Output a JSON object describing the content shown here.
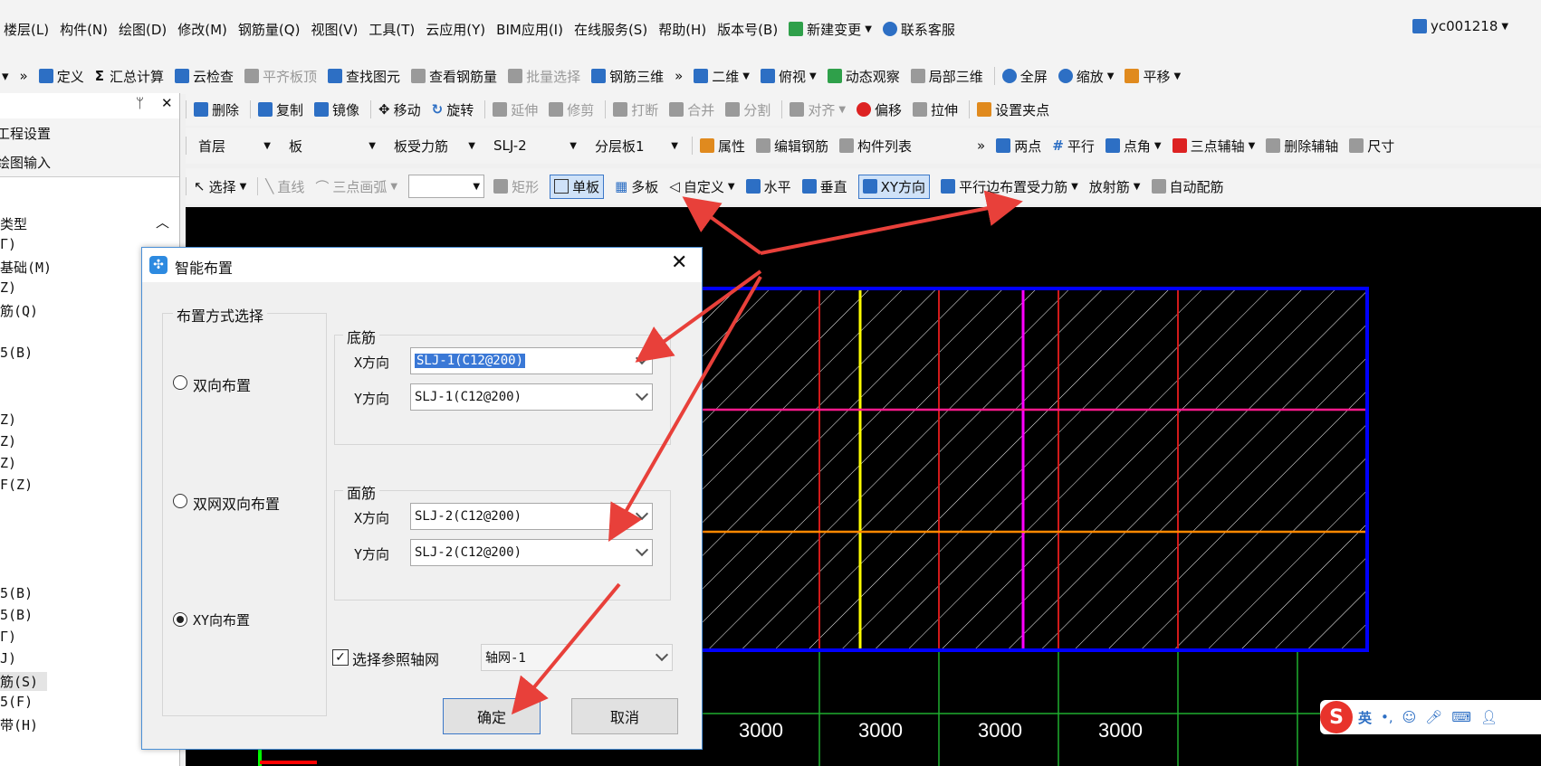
{
  "menu": {
    "items": [
      "楼层(L)",
      "构件(N)",
      "绘图(D)",
      "修改(M)",
      "钢筋量(Q)",
      "视图(V)",
      "工具(T)",
      "云应用(Y)",
      "BIM应用(I)",
      "在线服务(S)",
      "帮助(H)",
      "版本号(B)"
    ],
    "new_change": "新建变更",
    "support": "联系客服",
    "user": "yc001218"
  },
  "toolbar1": {
    "define": "定义",
    "sum": "汇总计算",
    "cloud_check": "云检查",
    "flush_slab": "平齐板顶",
    "find": "查找图元",
    "view_rebar": "查看钢筋量",
    "batch_select": "批量选择",
    "rebar_3d": "钢筋三维",
    "view_2d": "二维",
    "top_view": "俯视",
    "dynamic": "动态观察",
    "local_3d": "局部三维",
    "fullscreen": "全屏",
    "zoom": "缩放",
    "pan": "平移"
  },
  "toolbar2": {
    "delete": "删除",
    "copy": "复制",
    "mirror": "镜像",
    "move": "移动",
    "rotate": "旋转",
    "extend": "延伸",
    "trim": "修剪",
    "break": "打断",
    "merge": "合并",
    "split": "分割",
    "align": "对齐",
    "offset": "偏移",
    "stretch": "拉伸",
    "grip": "设置夹点"
  },
  "toolbar3": {
    "floor": "首层",
    "type": "板",
    "category": "板受力筋",
    "name": "SLJ-2",
    "layer": "分层板1",
    "props": "属性",
    "edit_rebar": "编辑钢筋",
    "comp_list": "构件列表",
    "two_point": "两点",
    "parallel": "平行",
    "point_angle": "点角",
    "three_point_axis": "三点辅轴",
    "del_axis": "删除辅轴",
    "dim": "尺寸"
  },
  "toolbar4": {
    "select": "选择",
    "line": "直线",
    "arc": "三点画弧",
    "rect": "矩形",
    "single": "单板",
    "multi": "多板",
    "custom": "自定义",
    "horizontal": "水平",
    "vertical": "垂直",
    "xy": "XY方向",
    "parallel_edge": "平行边布置受力筋",
    "radial": "放射筋",
    "auto": "自动配筋"
  },
  "leftpanel": {
    "pin": "ᛘ",
    "close": "✕",
    "project_settings": "工程设置",
    "drawing_input": "绘图输入",
    "items": [
      "类型",
      "Γ)",
      "基础(M)",
      "Z)",
      "筋(Q)",
      "5(B)",
      "Z)",
      "Z)",
      "Z)",
      "F(Z)",
      "5(B)",
      "5(B)",
      "Γ)",
      "J)",
      "筋(S)",
      "5(F)",
      "带(H)"
    ]
  },
  "dialog": {
    "title": "智能布置",
    "group_title": "布置方式选择",
    "radio_two_way": "双向布置",
    "radio_double_net": "双网双向布置",
    "radio_xy": "XY向布置",
    "bottom": "底筋",
    "top": "面筋",
    "x_label": "X方向",
    "y_label": "Y方向",
    "bottom_x": "SLJ-1(C12@200)",
    "bottom_y": "SLJ-1(C12@200)",
    "top_x": "SLJ-2(C12@200)",
    "top_y": "SLJ-2(C12@200)",
    "ref_grid": "选择参照轴网",
    "grid_value": "轴网-1",
    "ok": "确定",
    "cancel": "取消"
  },
  "canvas": {
    "dims": [
      "3000",
      "3000",
      "3000",
      "3000"
    ]
  },
  "ime": {
    "lang": "英",
    "punct": "•,"
  },
  "colors": {
    "slab_border": "#0000ff",
    "grid_red": "#d11a1a",
    "grid_yellow": "#ffff00",
    "grid_magenta": "#ff00ff",
    "grid_pink": "#ff1a8c",
    "grid_orange": "#ff8800",
    "arrow": "#e8403a"
  }
}
